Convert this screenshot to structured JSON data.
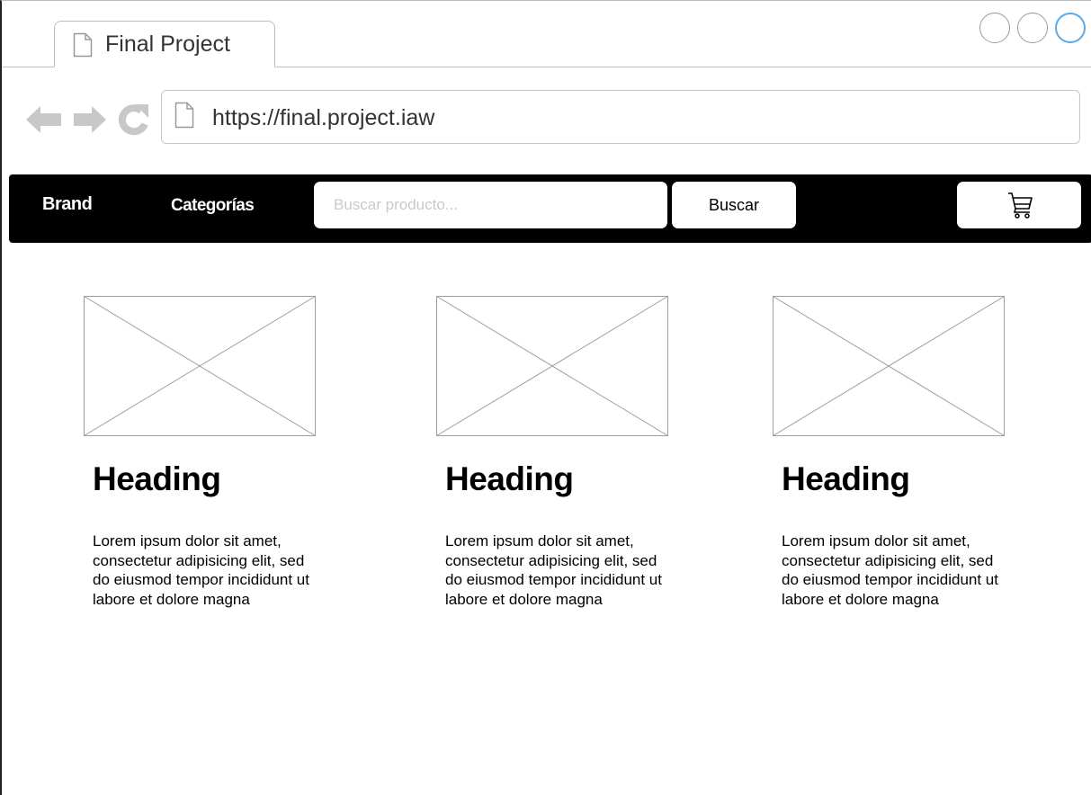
{
  "browser": {
    "tab_title": "Final Project",
    "url": "https://final.project.iaw",
    "accent_color": "#5aa9e6"
  },
  "navbar": {
    "brand": "Brand",
    "categories_label": "Categorías",
    "search_placeholder": "Buscar producto...",
    "search_button_label": "Buscar",
    "cart_icon": "shopping-cart-icon",
    "background_color": "#000000"
  },
  "cards": [
    {
      "heading": "Heading",
      "body": "Lorem ipsum dolor sit amet, consectetur adipisicing elit, sed do eiusmod tempor incididunt ut labore et dolore magna"
    },
    {
      "heading": "Heading",
      "body": "Lorem ipsum dolor sit amet, consectetur adipisicing elit, sed do eiusmod tempor incididunt ut labore et dolore magna"
    },
    {
      "heading": "Heading",
      "body": "Lorem ipsum dolor sit amet, consectetur adipisicing elit, sed do eiusmod tempor incididunt ut labore et dolore magna"
    }
  ]
}
